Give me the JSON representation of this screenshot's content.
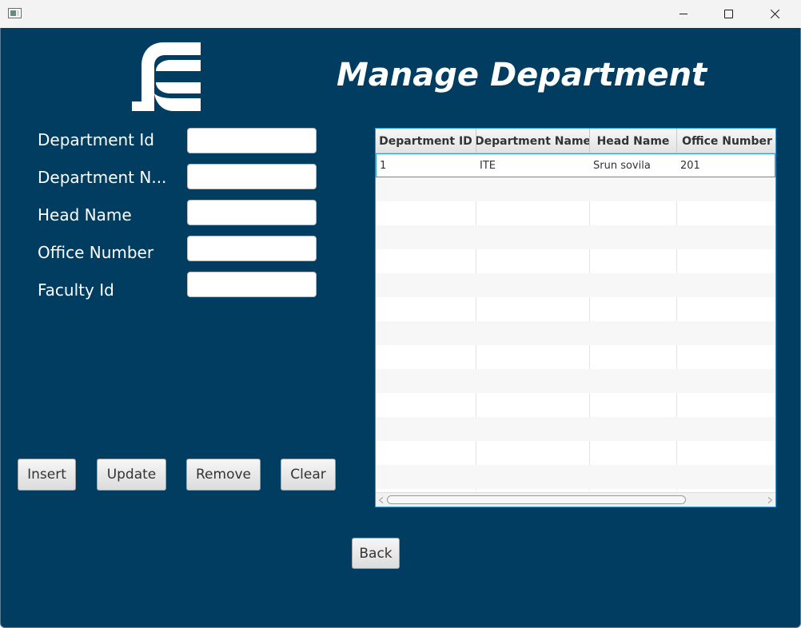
{
  "window": {
    "icon": "app-window-icon",
    "controls": [
      "minimize-icon",
      "maximize-icon",
      "close-icon"
    ]
  },
  "logo": {
    "icon": "fe-logo-icon",
    "color": "#ffffff"
  },
  "header": {
    "title": "Manage Department"
  },
  "form": {
    "fields": [
      {
        "label": "Department Id",
        "value": ""
      },
      {
        "label": "Department N...",
        "value": ""
      },
      {
        "label": "Head Name",
        "value": ""
      },
      {
        "label": "Office Number",
        "value": ""
      },
      {
        "label": "Faculty Id",
        "value": ""
      }
    ]
  },
  "actions": {
    "insert": "Insert",
    "update": "Update",
    "remove": "Remove",
    "clear": "Clear",
    "back": "Back"
  },
  "table": {
    "columns": [
      "Department ID",
      "Department Name",
      "Head Name",
      "Office Number"
    ],
    "rows": [
      [
        "1",
        "ITE",
        "Srun sovila",
        "201"
      ]
    ],
    "selected_row": 0
  },
  "colors": {
    "background": "#003d61",
    "accent": "#2a9fd6",
    "text_light": "#ffffff"
  }
}
